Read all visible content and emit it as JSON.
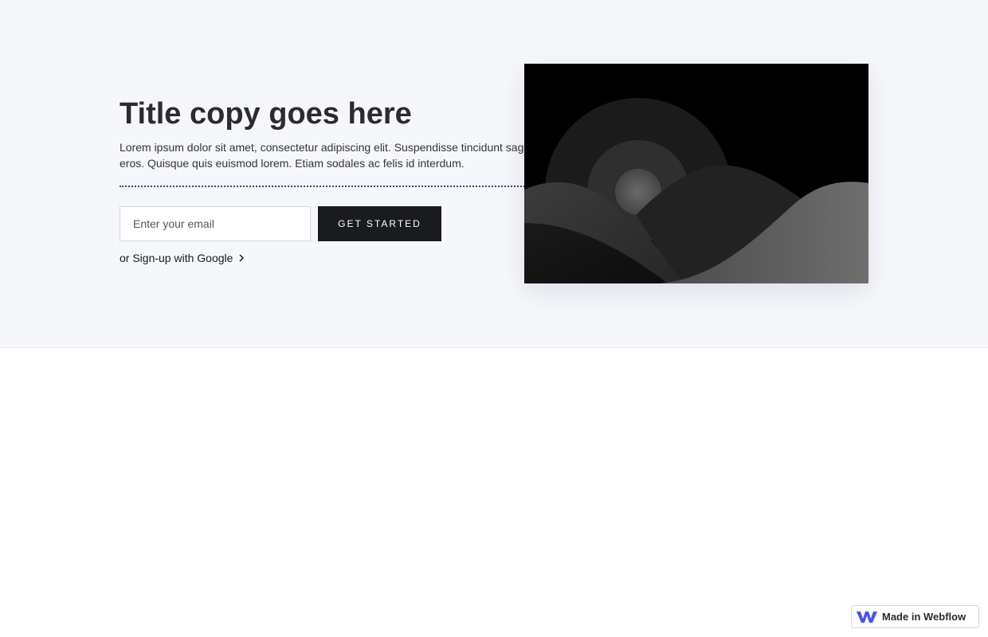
{
  "hero": {
    "title": "Title copy goes here",
    "paragraph": "Lorem ipsum dolor sit amet, consectetur adipiscing elit. Suspendisse tincidunt sagittis eros. Quisque quis euismod lorem. Etiam sodales ac felis id interdum.",
    "email_placeholder": "Enter your email",
    "cta_label": "GET STARTED",
    "google_link": "or Sign-up with Google"
  },
  "image": {
    "icon": "placeholder-landscape-image"
  },
  "badge": {
    "label": "Made in Webflow",
    "icon": "webflow-logo-icon",
    "brand_color": "#4353ff"
  },
  "colors": {
    "hero_background": "#f6f7fb",
    "button_background": "#1a1b1f",
    "title_color": "#2c2c30"
  }
}
